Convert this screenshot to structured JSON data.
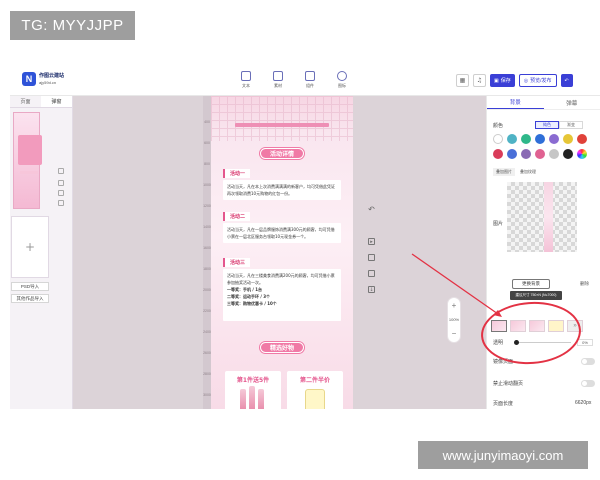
{
  "watermark_top": "TG: MYYJJPP",
  "watermark_bottom": "www.junyimaoyi.com",
  "logo": {
    "name": "作图云建站",
    "sub": "ajy59d.cn",
    "mark": "N"
  },
  "toolbar": {
    "items": [
      "文本",
      "素材",
      "组件",
      "图标"
    ],
    "save": "保存",
    "preview": "预览/发布",
    "undo": "↶"
  },
  "left": {
    "tabs": [
      "页面",
      "弹窗"
    ],
    "add": "+",
    "psd": "PSD导入",
    "other": "其他作品导入"
  },
  "ruler": [
    "400",
    "600",
    "800",
    "1000",
    "1200",
    "1400",
    "1600",
    "1800",
    "2000",
    "2200",
    "2400",
    "2600",
    "2800",
    "3000"
  ],
  "page": {
    "section1": "活动详情",
    "section2": "精选好物",
    "acts": [
      {
        "label": "活动一",
        "text": "活动当天，凡在本上次消费满满满的新客户，均可凭借此凭证再次领取消费10元购物的红包一份。"
      },
      {
        "label": "活动二",
        "text": "活动当天，凡在一层品牌服饰消费满300元的顾客，均可凭借小票在一层北区服务台领取10元现金券一个。"
      },
      {
        "label": "活动三",
        "text": "活动当天，凡在三楼美食消费满200元的顾客，均可凭借小票参加抽奖活动一次。",
        "prizes": [
          "一等奖：手机 / 1台",
          "二等奖：运动手环 / 3个",
          "三等奖：购物优惠卡 / 10个"
        ]
      }
    ],
    "cards": [
      "第1件送5件",
      "第二件半价"
    ]
  },
  "zoom": {
    "plus": "+",
    "value": "100%",
    "minus": "−"
  },
  "right": {
    "tabs": [
      "背景",
      "弹幕"
    ],
    "color_label": "颜色",
    "color_modes": [
      "纯色",
      "渐变"
    ],
    "colors": [
      "#ffffff",
      "#4fb3c5",
      "#2fb88a",
      "#2f6fd8",
      "#8a6bd1",
      "#e6c637",
      "#e0423a",
      "#d93c5a",
      "#4a6fd8",
      "#8a6ab4",
      "#e06292",
      "#c6c6c6",
      "#222222",
      "#ff9c2e"
    ],
    "subtabs": [
      "叠加图片",
      "叠加纹理"
    ],
    "image_label": "图片",
    "change_btn": "更换背景",
    "delete_btn": "删除",
    "tip": "建议尺寸 750×N (N≤7000)",
    "opacity_label": "透明",
    "opacity_value": "0%",
    "mirror_label": "镜像页面",
    "scroll_label": "禁止滑动翻页",
    "height_label": "页面长度",
    "height_value": "6620px"
  }
}
